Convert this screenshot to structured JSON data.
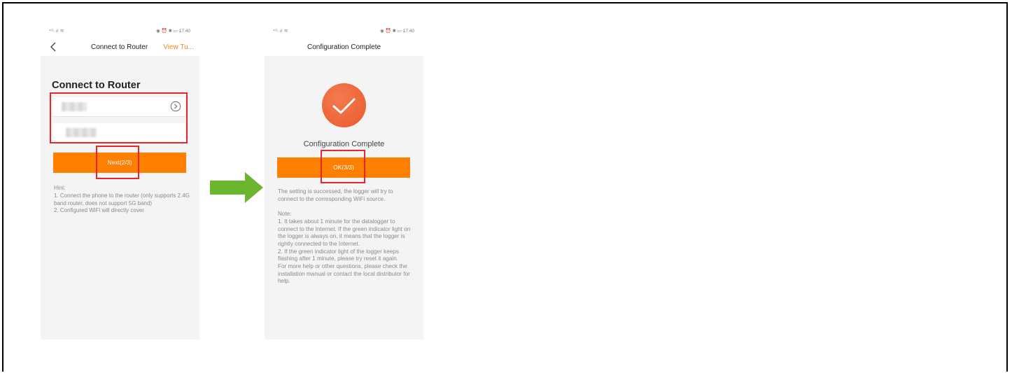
{
  "phone1": {
    "status": {
      "signal": "⁴ᴳ.ıl ≋",
      "right": "◉ ⏰ ✱ ▭ 17:40"
    },
    "nav_title": "Connect to Router",
    "nav_link": "View Tu...",
    "page_title": "Connect to Router",
    "next_button": "Next(2/3)",
    "hint": {
      "heading": "Hint:",
      "line1": "1. Connect the phone to the router (only supports 2.4G band router, does not support 5G band)",
      "line2": "2. Configured WiFi will directly cover"
    }
  },
  "phone2": {
    "status": {
      "signal": "⁴ᴳ.ıl ≋",
      "right": "◉ ⏰ ✱ ▭ 17:40"
    },
    "nav_title": "Configuration Complete",
    "complete_text": "Configuration Complete",
    "ok_button": "OK(3/3)",
    "success_text": "The setting is successed, the logger will try to connect to the corresponding WiFi source.",
    "note": {
      "heading": "Note:",
      "line1": "1. It takes about 1 minute for the datalogger to connect to the Internet. If the green indicator light on the logger is always on, it means that the logger is rightly connected to the Internet.",
      "line2": "2. If the green indicator light of the logger keeps flashing after 1 minute, please try reset it again.",
      "line3": "For more help or other questions, please check the installation manual or contact the local distributor for help."
    }
  },
  "colors": {
    "accent": "#ff7f00",
    "highlight": "#e8242c",
    "arrow": "#6bb52f",
    "check": "#ea5a2c"
  },
  "icons": [
    "back-chevron-icon",
    "circle-chevron-right-icon",
    "checkmark-icon",
    "right-arrow-icon"
  ]
}
